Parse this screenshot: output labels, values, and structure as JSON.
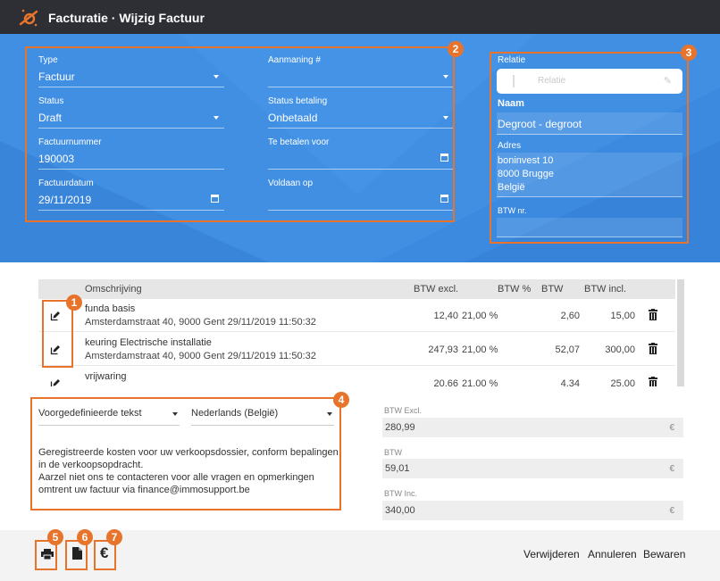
{
  "header": {
    "title": "Facturatie · Wijzig Factuur"
  },
  "invoice_fields": {
    "type": {
      "label": "Type",
      "value": "Factuur"
    },
    "aanmaning": {
      "label": "Aanmaning #",
      "value": ""
    },
    "status": {
      "label": "Status",
      "value": "Draft"
    },
    "status_betaling": {
      "label": "Status betaling",
      "value": "Onbetaald"
    },
    "factuurnummer": {
      "label": "Factuurnummer",
      "value": "190003"
    },
    "te_betalen_voor": {
      "label": "Te betalen voor",
      "value": ""
    },
    "factuurdatum": {
      "label": "Factuurdatum",
      "value": "29/11/2019"
    },
    "voldaan_op": {
      "label": "Voldaan op",
      "value": ""
    }
  },
  "relatie": {
    "label": "Relatie",
    "search_placeholder": "Relatie",
    "naam_label": "Naam",
    "naam_value": "Degroot - degroot",
    "adres_label": "Adres",
    "adres_lines": [
      "boninvest 10",
      "8000 Brugge",
      "België"
    ],
    "btw_label": "BTW nr.",
    "btw_value": ""
  },
  "table": {
    "headers": {
      "omschrijving": "Omschrijving",
      "btw_excl": "BTW excl.",
      "btw_pct": "BTW %",
      "btw": "BTW",
      "btw_incl": "BTW incl."
    },
    "rows": [
      {
        "title": "funda basis",
        "detail": "Amsterdamstraat 40, 9000 Gent 29/11/2019 11:50:32",
        "excl": "12,40",
        "pct": "21,00 %",
        "btw": "2,60",
        "incl": "15,00"
      },
      {
        "title": "keuring Electrische installatie",
        "detail": "Amsterdamstraat 40, 9000 Gent 29/11/2019 11:50:32",
        "excl": "247,93",
        "pct": "21,00 %",
        "btw": "52,07",
        "incl": "300,00"
      },
      {
        "title": "vrijwaring",
        "detail": "",
        "excl": "20,66",
        "pct": "21,00 %",
        "btw": "4,34",
        "incl": "25,00"
      }
    ]
  },
  "text_section": {
    "predefined_label": "Voorgedefinieerde tekst",
    "language_value": "Nederlands (België)",
    "body_lines": [
      "Geregistreerde kosten voor uw verkoopsdossier, conform bepalingen",
      "in de verkoopsopdracht.",
      "Aarzel niet ons te contacteren voor alle vragen en opmerkingen",
      "omtrent uw factuur via finance@immosupport.be"
    ]
  },
  "summary": {
    "excl_label": "BTW Excl.",
    "excl_value": "280,99",
    "btw_label": "BTW",
    "btw_value": "59,01",
    "inc_label": "BTW Inc.",
    "inc_value": "340,00",
    "currency": "€"
  },
  "annotations": {
    "b1": "1",
    "b2": "2",
    "b3": "3",
    "b4": "4",
    "b5": "5",
    "b6": "6",
    "b7": "7"
  },
  "footer": {
    "euro_glyph": "€",
    "verwijderen": "Verwijderen",
    "annuleren": "Annuleren",
    "bewaren": "Bewaren"
  },
  "colors": {
    "accent": "#e8742c",
    "hero": "#3c8ae0",
    "titlebar": "#2e2f35"
  },
  "icons": [
    "logo-icon",
    "caret-down-icon",
    "calendar-icon",
    "pencil-icon",
    "edit-icon",
    "trash-icon",
    "print-icon",
    "document-icon",
    "euro-icon"
  ]
}
